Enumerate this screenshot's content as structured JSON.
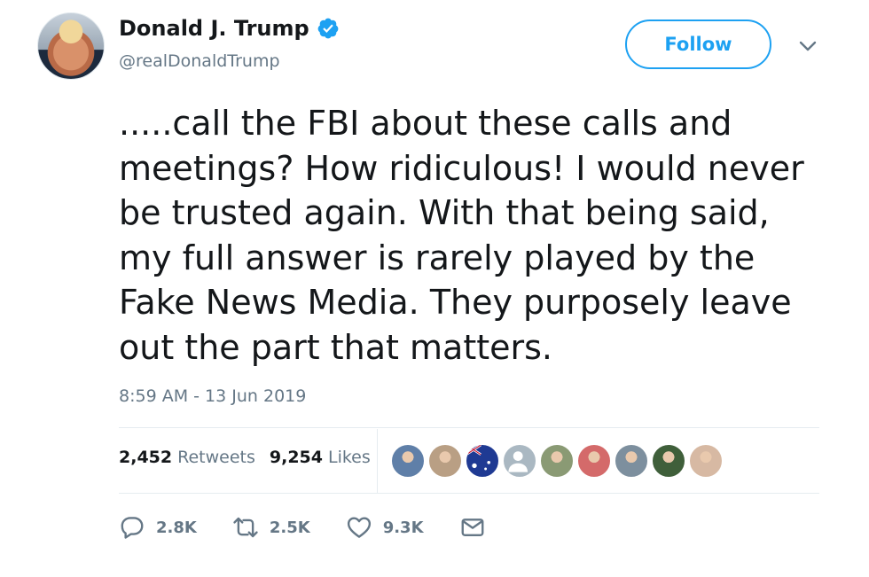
{
  "author": {
    "display_name": "Donald J. Trump",
    "handle": "@realDonaldTrump",
    "verified": true
  },
  "follow_label": "Follow",
  "tweet": {
    "text": ".....call the FBI about these calls and\nmeetings? How ridiculous! I would never\nbe trusted again. With that being said,\nmy full answer is rarely played by the\nFake News Media. They purposely leave\nout the part that matters.",
    "timestamp": "8:59 AM - 13 Jun 2019"
  },
  "stats": {
    "retweets_count": "2,452",
    "retweets_label": "Retweets",
    "likes_count": "9,254",
    "likes_label": "Likes"
  },
  "liker_avatars": [
    {
      "name": "liker-avatar-1",
      "color": "#5f7fa8"
    },
    {
      "name": "liker-avatar-2",
      "color": "#b99f84"
    },
    {
      "name": "liker-avatar-3-flag",
      "color": "#1f3a93"
    },
    {
      "name": "liker-avatar-4-default",
      "color": "#aab8c2"
    },
    {
      "name": "liker-avatar-5",
      "color": "#8a9a74"
    },
    {
      "name": "liker-avatar-6",
      "color": "#d46a6a"
    },
    {
      "name": "liker-avatar-7",
      "color": "#7d8f9e"
    },
    {
      "name": "liker-avatar-8",
      "color": "#3f5f3a"
    },
    {
      "name": "liker-avatar-9",
      "color": "#d7b9a3"
    }
  ],
  "actions": {
    "reply_count": "2.8K",
    "retweet_count": "2.5K",
    "like_count": "9.3K"
  },
  "colors": {
    "accent": "#1da1f2",
    "text": "#14171a",
    "secondary_text": "#657786",
    "border": "#e6ecf0"
  },
  "icons": [
    "verified-badge-icon",
    "chevron-down-icon",
    "reply-icon",
    "retweet-icon",
    "heart-icon",
    "envelope-icon"
  ]
}
